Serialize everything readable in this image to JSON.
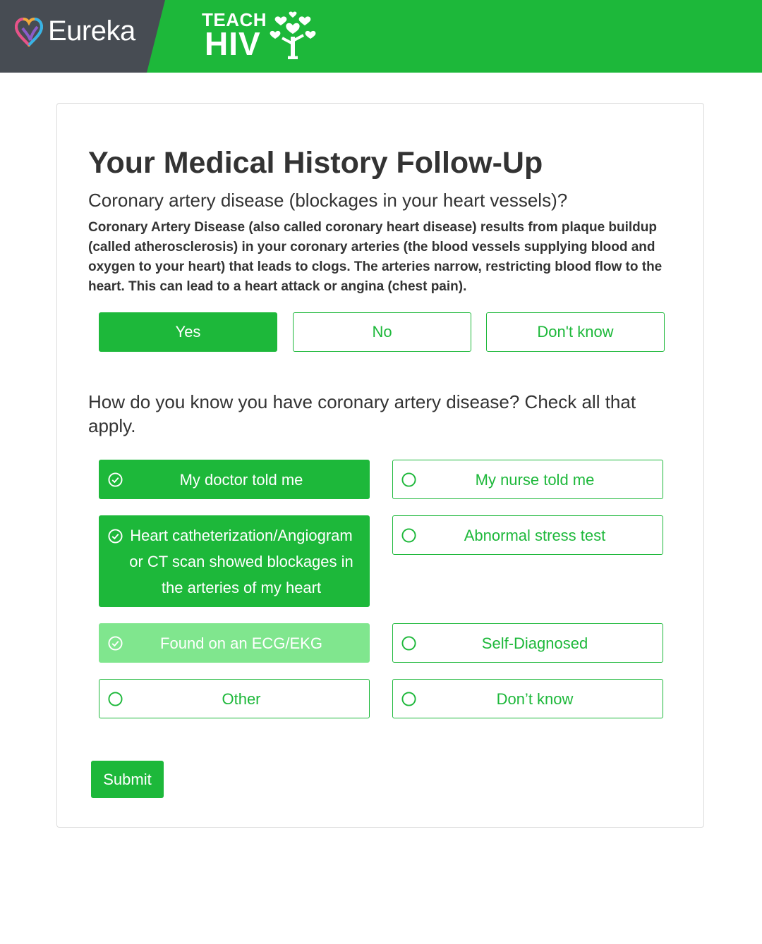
{
  "header": {
    "brand_name": "Eureka",
    "program_logo_top": "TEACH",
    "program_logo_bottom": "HIV",
    "logo_icon": "heart-logo-icon",
    "tree_icon": "tree-icon",
    "colors": {
      "header_bg": "#1db83a",
      "brand_panel_bg": "#474c53"
    }
  },
  "card": {
    "title": "Your Medical History Follow-Up",
    "question": "Coronary artery disease (blockages in your heart vessels)?",
    "description": "Coronary Artery Disease (also called coronary heart disease) results from plaque buildup (called atherosclerosis) in your coronary arteries (the blood vessels supplying blood and oxygen to your heart) that leads to clogs. The arteries narrow, restricting blood flow to the heart. This can lead to a heart attack or angina (chest pain).",
    "answers": [
      {
        "label": "Yes",
        "selected": true
      },
      {
        "label": "No",
        "selected": false
      },
      {
        "label": "Don't know",
        "selected": false
      }
    ],
    "followup_question": "How do you know you have coronary artery disease? Check all that apply.",
    "options": [
      {
        "label": "My doctor told me",
        "state": "checked",
        "icon": "check-circle-icon"
      },
      {
        "label": "My nurse told me",
        "state": "unchecked",
        "icon": "circle-icon"
      },
      {
        "label": "Heart catheterization/Angiogram or CT scan showed blockages in the arteries of my heart",
        "state": "checked",
        "icon": "check-circle-icon"
      },
      {
        "label": "Abnormal stress test",
        "state": "unchecked",
        "icon": "circle-icon"
      },
      {
        "label": "Found on an ECG/EKG",
        "state": "checked-light",
        "icon": "check-circle-icon"
      },
      {
        "label": "Self-Diagnosed",
        "state": "unchecked",
        "icon": "circle-icon"
      },
      {
        "label": "Other",
        "state": "unchecked",
        "icon": "circle-icon"
      },
      {
        "label": "Don’t know",
        "state": "unchecked",
        "icon": "circle-icon"
      }
    ],
    "submit_label": "Submit",
    "colors": {
      "accent": "#1db83a",
      "accent_light": "#80e68e",
      "text": "#333333"
    }
  }
}
